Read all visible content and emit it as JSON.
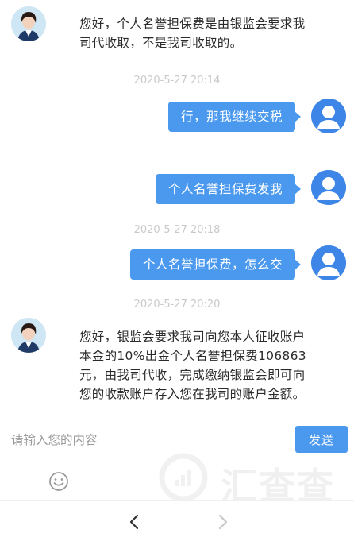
{
  "messages": [
    {
      "type": "agent",
      "text_lines": [
        "您好，个人名誉担保费是由银监会要求我",
        "司代收取，不是我司收取的。"
      ]
    },
    {
      "type": "timestamp",
      "text": "2020-5-27 20:14"
    },
    {
      "type": "user",
      "text": "行，那我继续交税"
    },
    {
      "type": "user",
      "text": "个人名誉担保费发我"
    },
    {
      "type": "timestamp",
      "text": "2020-5-27 20:18"
    },
    {
      "type": "user",
      "text": "个人名誉担保费，怎么交"
    },
    {
      "type": "timestamp",
      "text": "2020-5-27 20:20"
    },
    {
      "type": "agent",
      "text_lines": [
        "您好，银监会要求我司向您本人征收账户",
        "本金的10%出金个人名誉担保费106863",
        "元，由我司代收，完成缴纳银监会即可向",
        "您的收款账户存入您在我司的账户金额。"
      ]
    }
  ],
  "input": {
    "placeholder": "请输入您的内容",
    "value": ""
  },
  "send_label": "发送",
  "icons": {
    "emoji": "emoji-icon",
    "back": "chevron-left-icon",
    "forward": "chevron-right-icon"
  },
  "watermark": {
    "text": "汇查查"
  },
  "colors": {
    "accent": "#4b99ef",
    "timestamp": "#c9c9c9"
  }
}
